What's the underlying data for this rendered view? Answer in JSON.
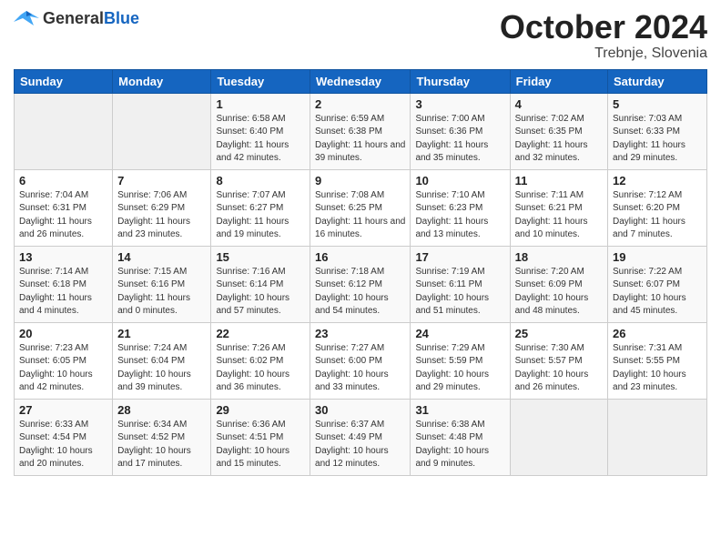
{
  "header": {
    "logo_general": "General",
    "logo_blue": "Blue",
    "title": "October 2024",
    "location": "Trebnje, Slovenia"
  },
  "weekdays": [
    "Sunday",
    "Monday",
    "Tuesday",
    "Wednesday",
    "Thursday",
    "Friday",
    "Saturday"
  ],
  "weeks": [
    [
      {
        "day": "",
        "info": ""
      },
      {
        "day": "",
        "info": ""
      },
      {
        "day": "1",
        "info": "Sunrise: 6:58 AM\nSunset: 6:40 PM\nDaylight: 11 hours and 42 minutes."
      },
      {
        "day": "2",
        "info": "Sunrise: 6:59 AM\nSunset: 6:38 PM\nDaylight: 11 hours and 39 minutes."
      },
      {
        "day": "3",
        "info": "Sunrise: 7:00 AM\nSunset: 6:36 PM\nDaylight: 11 hours and 35 minutes."
      },
      {
        "day": "4",
        "info": "Sunrise: 7:02 AM\nSunset: 6:35 PM\nDaylight: 11 hours and 32 minutes."
      },
      {
        "day": "5",
        "info": "Sunrise: 7:03 AM\nSunset: 6:33 PM\nDaylight: 11 hours and 29 minutes."
      }
    ],
    [
      {
        "day": "6",
        "info": "Sunrise: 7:04 AM\nSunset: 6:31 PM\nDaylight: 11 hours and 26 minutes."
      },
      {
        "day": "7",
        "info": "Sunrise: 7:06 AM\nSunset: 6:29 PM\nDaylight: 11 hours and 23 minutes."
      },
      {
        "day": "8",
        "info": "Sunrise: 7:07 AM\nSunset: 6:27 PM\nDaylight: 11 hours and 19 minutes."
      },
      {
        "day": "9",
        "info": "Sunrise: 7:08 AM\nSunset: 6:25 PM\nDaylight: 11 hours and 16 minutes."
      },
      {
        "day": "10",
        "info": "Sunrise: 7:10 AM\nSunset: 6:23 PM\nDaylight: 11 hours and 13 minutes."
      },
      {
        "day": "11",
        "info": "Sunrise: 7:11 AM\nSunset: 6:21 PM\nDaylight: 11 hours and 10 minutes."
      },
      {
        "day": "12",
        "info": "Sunrise: 7:12 AM\nSunset: 6:20 PM\nDaylight: 11 hours and 7 minutes."
      }
    ],
    [
      {
        "day": "13",
        "info": "Sunrise: 7:14 AM\nSunset: 6:18 PM\nDaylight: 11 hours and 4 minutes."
      },
      {
        "day": "14",
        "info": "Sunrise: 7:15 AM\nSunset: 6:16 PM\nDaylight: 11 hours and 0 minutes."
      },
      {
        "day": "15",
        "info": "Sunrise: 7:16 AM\nSunset: 6:14 PM\nDaylight: 10 hours and 57 minutes."
      },
      {
        "day": "16",
        "info": "Sunrise: 7:18 AM\nSunset: 6:12 PM\nDaylight: 10 hours and 54 minutes."
      },
      {
        "day": "17",
        "info": "Sunrise: 7:19 AM\nSunset: 6:11 PM\nDaylight: 10 hours and 51 minutes."
      },
      {
        "day": "18",
        "info": "Sunrise: 7:20 AM\nSunset: 6:09 PM\nDaylight: 10 hours and 48 minutes."
      },
      {
        "day": "19",
        "info": "Sunrise: 7:22 AM\nSunset: 6:07 PM\nDaylight: 10 hours and 45 minutes."
      }
    ],
    [
      {
        "day": "20",
        "info": "Sunrise: 7:23 AM\nSunset: 6:05 PM\nDaylight: 10 hours and 42 minutes."
      },
      {
        "day": "21",
        "info": "Sunrise: 7:24 AM\nSunset: 6:04 PM\nDaylight: 10 hours and 39 minutes."
      },
      {
        "day": "22",
        "info": "Sunrise: 7:26 AM\nSunset: 6:02 PM\nDaylight: 10 hours and 36 minutes."
      },
      {
        "day": "23",
        "info": "Sunrise: 7:27 AM\nSunset: 6:00 PM\nDaylight: 10 hours and 33 minutes."
      },
      {
        "day": "24",
        "info": "Sunrise: 7:29 AM\nSunset: 5:59 PM\nDaylight: 10 hours and 29 minutes."
      },
      {
        "day": "25",
        "info": "Sunrise: 7:30 AM\nSunset: 5:57 PM\nDaylight: 10 hours and 26 minutes."
      },
      {
        "day": "26",
        "info": "Sunrise: 7:31 AM\nSunset: 5:55 PM\nDaylight: 10 hours and 23 minutes."
      }
    ],
    [
      {
        "day": "27",
        "info": "Sunrise: 6:33 AM\nSunset: 4:54 PM\nDaylight: 10 hours and 20 minutes."
      },
      {
        "day": "28",
        "info": "Sunrise: 6:34 AM\nSunset: 4:52 PM\nDaylight: 10 hours and 17 minutes."
      },
      {
        "day": "29",
        "info": "Sunrise: 6:36 AM\nSunset: 4:51 PM\nDaylight: 10 hours and 15 minutes."
      },
      {
        "day": "30",
        "info": "Sunrise: 6:37 AM\nSunset: 4:49 PM\nDaylight: 10 hours and 12 minutes."
      },
      {
        "day": "31",
        "info": "Sunrise: 6:38 AM\nSunset: 4:48 PM\nDaylight: 10 hours and 9 minutes."
      },
      {
        "day": "",
        "info": ""
      },
      {
        "day": "",
        "info": ""
      }
    ]
  ]
}
